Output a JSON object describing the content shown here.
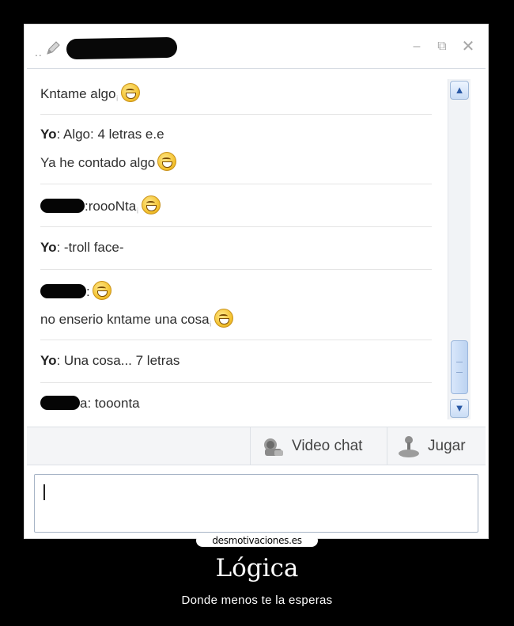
{
  "window": {
    "edit_glyph": "✎",
    "dots": "..",
    "minimize": "–",
    "restore": "⧉",
    "close": "✕"
  },
  "messages": {
    "m1": {
      "text": "Kntame algo",
      "mark": "¡"
    },
    "m2": {
      "who": "Yo",
      "text": ": Algo: 4 letras e.e",
      "reply": "Ya he contado algo"
    },
    "m3": {
      "text": ":roooNta",
      "mark": "¡"
    },
    "m4": {
      "who": "Yo",
      "text": ": -troll face-"
    },
    "m5": {
      "sep": ":",
      "text": "no enserio kntame una cosa",
      "mark": "¡"
    },
    "m6": {
      "who": "Yo",
      "text": ": Una cosa... 7 letras"
    },
    "m7": {
      "text": "a: tooonta"
    }
  },
  "toolbar": {
    "video_label": "Video chat",
    "play_label": "Jugar"
  },
  "input": {
    "value": ""
  },
  "footer": {
    "site": "desmotivaciones.es",
    "title": "Lógica",
    "subtitle": "Donde menos te la esperas"
  },
  "icons": [
    "pencil-icon",
    "emoticon-icon",
    "scroll-up-icon",
    "scroll-down-icon",
    "video-chat-icon",
    "game-controller-icon"
  ],
  "colors": {
    "scroll_accent": "#2b5aa6",
    "emoticon": "#f3c12e"
  }
}
